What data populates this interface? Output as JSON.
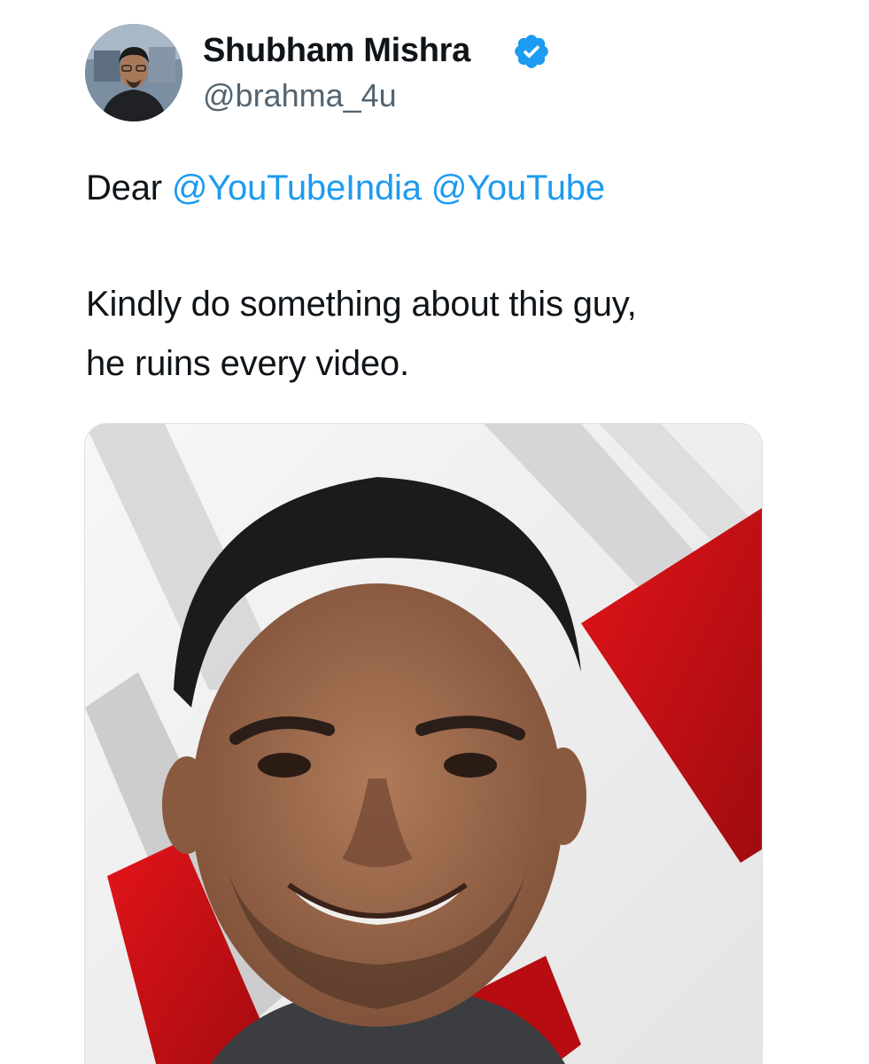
{
  "tweet": {
    "author": {
      "display_name": "Shubham Mishra",
      "handle": "@brahma_4u",
      "verified": true,
      "avatar_icon": "profile-photo"
    },
    "body": {
      "greeting": "Dear",
      "mentions": [
        "@YouTubeIndia",
        "@YouTube"
      ],
      "line2": "Kindly do something about this guy,",
      "line3": "he ruins every video."
    },
    "media": {
      "description_icon": "photo-of-smiling-man"
    }
  },
  "colors": {
    "mention": "#1d9bf0",
    "verified_badge": "#1d9bf0",
    "text": "#0f1419",
    "handle": "#536471",
    "accent_red": "#d20f14"
  }
}
